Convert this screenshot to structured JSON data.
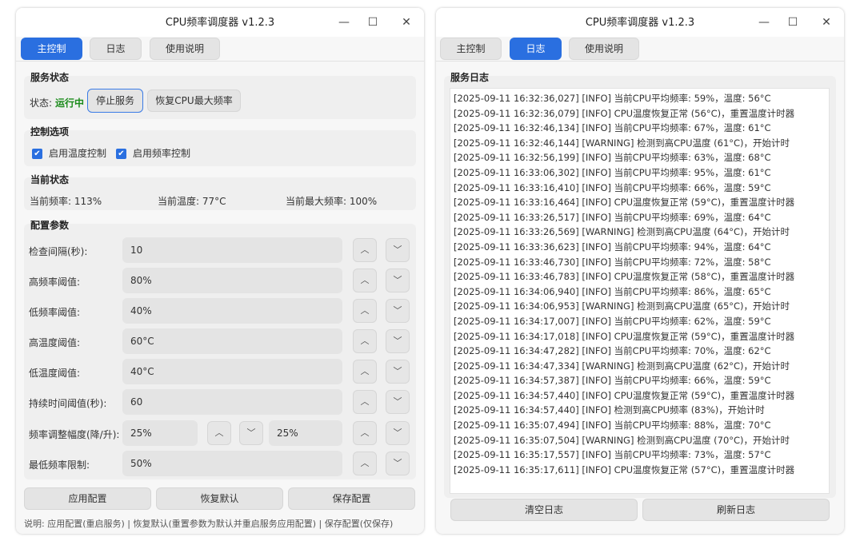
{
  "window_title": "CPU频率调度器 v1.2.3",
  "window_controls": {
    "minimize": "—",
    "maximize": "☐",
    "close": "✕"
  },
  "tabs": [
    "主控制",
    "日志",
    "使用说明"
  ],
  "main": {
    "service_status": {
      "title": "服务状态",
      "status_label": "状态:",
      "status_value": "运行中",
      "status_color": "#1a8a1a",
      "stop_button": "停止服务",
      "restore_button": "恢复CPU最大频率"
    },
    "control_options": {
      "title": "控制选项",
      "temp_control": {
        "label": "启用温度控制",
        "checked": true
      },
      "freq_control": {
        "label": "启用频率控制",
        "checked": true
      }
    },
    "current_status": {
      "title": "当前状态",
      "freq": "当前频率: 113%",
      "temp": "当前温度: 77°C",
      "max_freq": "当前最大频率: 100%"
    },
    "config": {
      "title": "配置参数",
      "rows": [
        {
          "label": "检查间隔(秒):",
          "value": "10"
        },
        {
          "label": "高频率阈值:",
          "value": "80%"
        },
        {
          "label": "低频率阈值:",
          "value": "40%"
        },
        {
          "label": "高温度阈值:",
          "value": "60°C"
        },
        {
          "label": "低温度阈值:",
          "value": "40°C"
        },
        {
          "label": "持续时间阈值(秒):",
          "value": "60"
        }
      ],
      "adjust": {
        "label": "频率调整幅度(降/升):",
        "down_value": "25%",
        "up_value": "25%"
      },
      "min_freq": {
        "label": "最低频率限制:",
        "value": "50%"
      }
    },
    "buttons": {
      "apply": "应用配置",
      "restore_default": "恢复默认",
      "save": "保存配置"
    },
    "note": "说明: 应用配置(重启服务) | 恢复默认(重置参数为默认并重启服务应用配置) | 保存配置(仅保存)"
  },
  "log_tab": {
    "title": "服务日志",
    "lines": [
      "[2025-09-11 16:32:36,027] [INFO] 当前CPU平均频率: 59%，温度: 56°C",
      "[2025-09-11 16:32:36,079] [INFO] CPU温度恢复正常 (56°C)，重置温度计时器",
      "[2025-09-11 16:32:46,134] [INFO] 当前CPU平均频率: 67%，温度: 61°C",
      "[2025-09-11 16:32:46,144] [WARNING] 检测到高CPU温度 (61°C)，开始计时",
      "[2025-09-11 16:32:56,199] [INFO] 当前CPU平均频率: 63%，温度: 68°C",
      "[2025-09-11 16:33:06,302] [INFO] 当前CPU平均频率: 95%，温度: 61°C",
      "[2025-09-11 16:33:16,410] [INFO] 当前CPU平均频率: 66%，温度: 59°C",
      "[2025-09-11 16:33:16,464] [INFO] CPU温度恢复正常 (59°C)，重置温度计时器",
      "[2025-09-11 16:33:26,517] [INFO] 当前CPU平均频率: 69%，温度: 64°C",
      "[2025-09-11 16:33:26,569] [WARNING] 检测到高CPU温度 (64°C)，开始计时",
      "[2025-09-11 16:33:36,623] [INFO] 当前CPU平均频率: 94%，温度: 64°C",
      "[2025-09-11 16:33:46,730] [INFO] 当前CPU平均频率: 72%，温度: 58°C",
      "[2025-09-11 16:33:46,783] [INFO] CPU温度恢复正常 (58°C)，重置温度计时器",
      "[2025-09-11 16:34:06,940] [INFO] 当前CPU平均频率: 86%，温度: 65°C",
      "[2025-09-11 16:34:06,953] [WARNING] 检测到高CPU温度 (65°C)，开始计时",
      "[2025-09-11 16:34:17,007] [INFO] 当前CPU平均频率: 62%，温度: 59°C",
      "[2025-09-11 16:34:17,018] [INFO] CPU温度恢复正常 (59°C)，重置温度计时器",
      "[2025-09-11 16:34:47,282] [INFO] 当前CPU平均频率: 70%，温度: 62°C",
      "[2025-09-11 16:34:47,334] [WARNING] 检测到高CPU温度 (62°C)，开始计时",
      "[2025-09-11 16:34:57,387] [INFO] 当前CPU平均频率: 66%，温度: 59°C",
      "[2025-09-11 16:34:57,440] [INFO] CPU温度恢复正常 (59°C)，重置温度计时器",
      "[2025-09-11 16:34:57,440] [INFO] 检测到高CPU频率 (83%)，开始计时",
      "[2025-09-11 16:35:07,494] [INFO] 当前CPU平均频率: 88%，温度: 70°C",
      "[2025-09-11 16:35:07,504] [WARNING] 检测到高CPU温度 (70°C)，开始计时",
      "[2025-09-11 16:35:17,557] [INFO] 当前CPU平均频率: 73%，温度: 57°C",
      "[2025-09-11 16:35:17,611] [INFO] CPU温度恢复正常 (57°C)，重置温度计时器"
    ],
    "clear_button": "清空日志",
    "refresh_button": "刷新日志"
  },
  "colors": {
    "accent": "#2a6fe0",
    "running": "#1a8a1a"
  }
}
